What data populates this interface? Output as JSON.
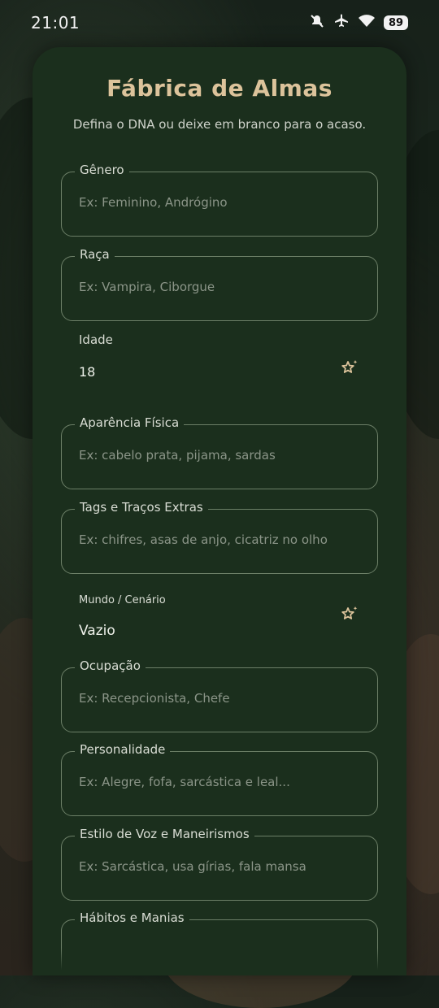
{
  "status_bar": {
    "time": "21:01",
    "icons": [
      "mute-icon",
      "airplane-icon",
      "wifi-icon"
    ],
    "battery": "89"
  },
  "header": {
    "title": "Fábrica de Almas",
    "subtitle": "Defina o DNA ou deixe em branco para o acaso."
  },
  "fields": {
    "genero": {
      "label": "Gênero",
      "placeholder": "Ex: Feminino, Andrógino"
    },
    "raca": {
      "label": "Raça",
      "placeholder": "Ex: Vampira, Ciborgue"
    },
    "idade": {
      "label": "Idade",
      "value": "18"
    },
    "aparencia": {
      "label": "Aparência Física",
      "placeholder": "Ex: cabelo prata, pijama, sardas"
    },
    "tags": {
      "label": "Tags e Traços Extras",
      "placeholder": "Ex: chifres, asas de anjo, cicatriz no olho"
    },
    "mundo": {
      "label": "Mundo / Cenário",
      "value": "Vazio"
    },
    "ocupacao": {
      "label": "Ocupação",
      "placeholder": "Ex: Recepcionista, Chefe"
    },
    "personalidade": {
      "label": "Personalidade",
      "placeholder": "Ex: Alegre, fofa, sarcástica e leal..."
    },
    "voz": {
      "label": "Estilo de Voz e Maneirismos",
      "placeholder": "Ex: Sarcástica, usa gírias, fala mansa"
    },
    "habitos": {
      "label": "Hábitos e Manias"
    }
  },
  "colors": {
    "card_background": "#1b2f1d",
    "accent": "#dcc39b",
    "border": "#6c7f67"
  }
}
